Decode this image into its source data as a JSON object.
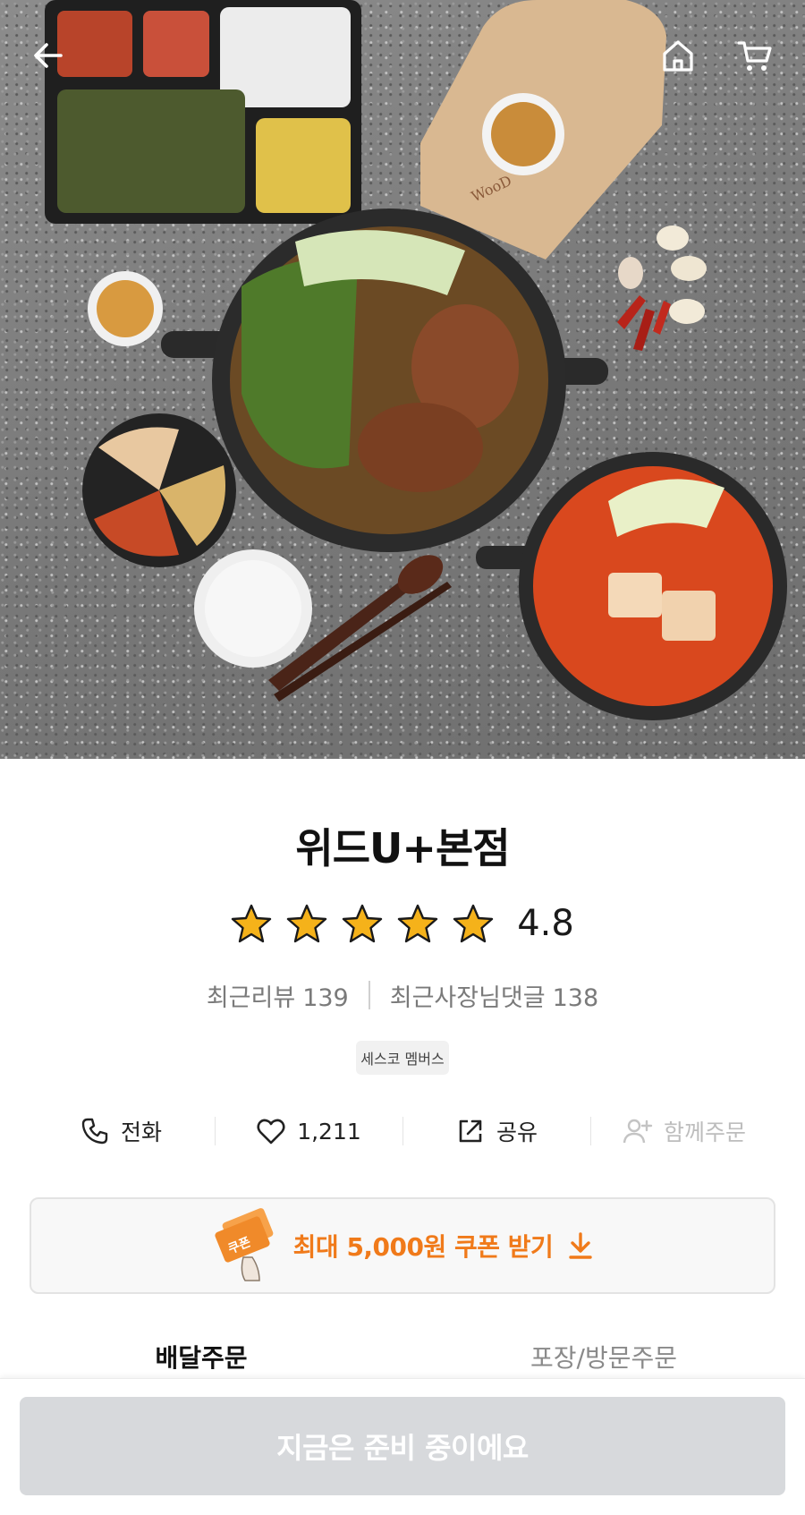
{
  "header": {
    "back_icon": "arrow-left-icon",
    "home_icon": "home-icon",
    "cart_icon": "cart-icon"
  },
  "hero": {
    "board_logo": "WooD"
  },
  "store": {
    "name": "위드U+본점",
    "rating": "4.8",
    "rating_value": 4.8,
    "rating_max": 5,
    "recent_review_label": "최근리뷰",
    "recent_review_count": "139",
    "owner_reply_label": "최근사장님댓글",
    "owner_reply_count": "138",
    "member_badge": "세스코 멤버스"
  },
  "actions": {
    "call_label": "전화",
    "like_count": "1,211",
    "share_label": "공유",
    "group_order_label": "함께주문"
  },
  "coupon": {
    "icon_label": "쿠폰",
    "text": "최대 5,000원 쿠폰 받기",
    "accent_color": "#f07a1a"
  },
  "order_tabs": [
    {
      "label": "배달주문",
      "active": true
    },
    {
      "label": "포장/방문주문",
      "active": false
    }
  ],
  "cta": {
    "label": "지금은 준비 중이에요",
    "disabled": true
  },
  "colors": {
    "star": "#f5b21a",
    "cta_disabled_bg": "#d7d9dc",
    "text_muted": "#7a7a7a"
  }
}
